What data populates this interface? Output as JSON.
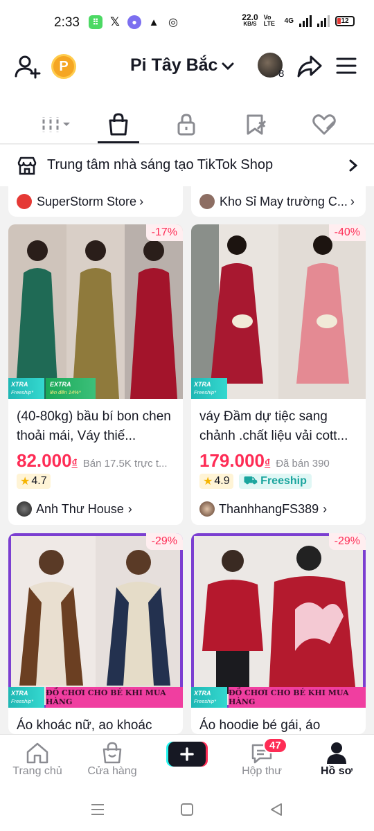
{
  "status_bar": {
    "time": "2:33",
    "net_speed_value": "22.0",
    "net_speed_unit": "KB/S",
    "volte": "Vo LTE",
    "network": "4G",
    "battery": "12"
  },
  "header": {
    "profile_name": "Pi Tây Bắc",
    "coin_letter": "P",
    "follower_avatar_count": "8"
  },
  "tabs": [
    {
      "name": "videos-grid",
      "icon": "grid-icon"
    },
    {
      "name": "shop",
      "icon": "shopping-bag-icon",
      "active": true
    },
    {
      "name": "private",
      "icon": "lock-icon"
    },
    {
      "name": "reposts",
      "icon": "bookmark-tag-icon"
    },
    {
      "name": "liked",
      "icon": "heart-icon"
    }
  ],
  "shop_center": {
    "label": "Trung tâm nhà sáng tạo TikTok Shop"
  },
  "stores_top": [
    {
      "name": "SuperStorm Store",
      "color": "#e53935"
    },
    {
      "name": "Kho Sỉ May trường C...",
      "color": "#8d6e63"
    }
  ],
  "products": [
    {
      "discount": "-17%",
      "badge_xtra": "XTRA",
      "badge_xtra_sub": "Freeship*",
      "badge_extra": "EXTRA",
      "badge_extra_sub": "lên đến 14%*",
      "title": "(40-80kg) bầu bí bon chen thoải mái, Váy thiế...",
      "price": "82.000",
      "currency": "₫",
      "sold": "Bán 17.5K trực t...",
      "rating": "4.7",
      "seller": "Anh Thư House"
    },
    {
      "discount": "-40%",
      "badge_xtra": "XTRA",
      "badge_xtra_sub": "Freeship*",
      "title": "váy Đầm dự tiệc sang chảnh .chất liệu vải cott...",
      "price": "179.000",
      "currency": "₫",
      "sold": "Đã bán 390",
      "rating": "4.9",
      "freeship": "Freeship",
      "seller": "ThanhhangFS389"
    },
    {
      "discount": "-29%",
      "badge_xtra": "XTRA",
      "badge_xtra_sub": "Freeship*",
      "promo": "ĐỒ CHƠI CHO BÉ KHI MUA HÀNG",
      "title": "Áo khoác nữ, ao khoác"
    },
    {
      "discount": "-29%",
      "badge_xtra": "XTRA",
      "badge_xtra_sub": "Freeship*",
      "promo": "ĐỒ CHƠI CHO BÉ KHI MUA HÀNG",
      "title": "Áo hoodie bé gái, áo"
    }
  ],
  "bottom_nav": {
    "home": "Trang chủ",
    "shop": "Cửa hàng",
    "inbox": "Hộp thư",
    "inbox_badge": "47",
    "profile": "Hồ sơ"
  }
}
